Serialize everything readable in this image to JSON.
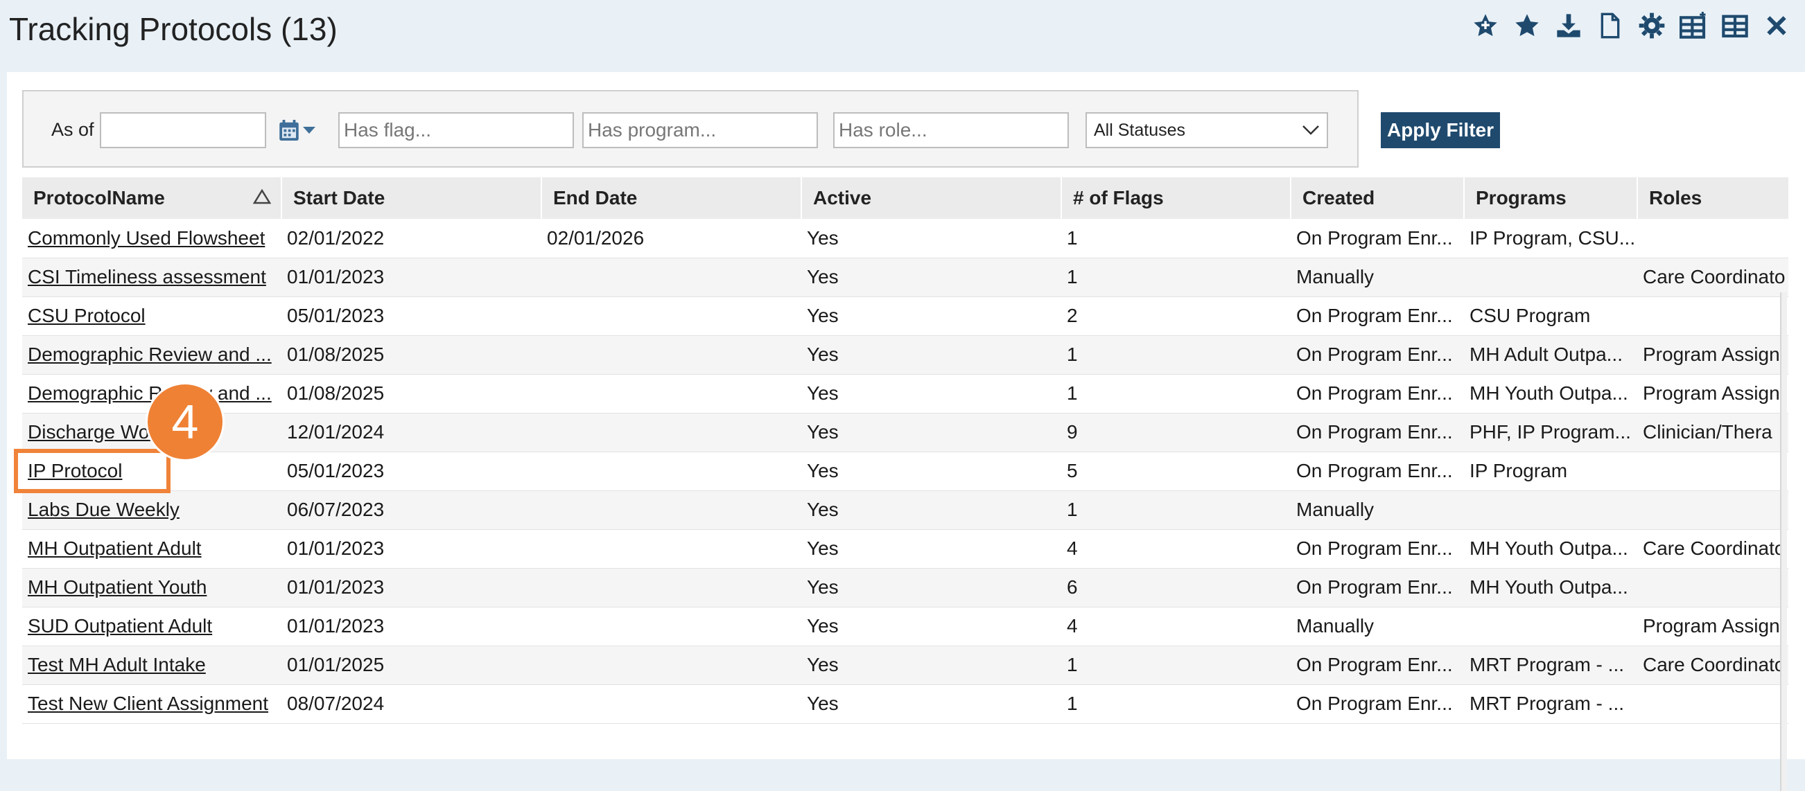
{
  "header": {
    "title": "Tracking Protocols (13)",
    "icons": [
      "add-favorite-icon",
      "star-icon",
      "download-icon",
      "document-icon",
      "gear-icon",
      "add-grid-icon",
      "grid-icon",
      "close-icon"
    ]
  },
  "filters": {
    "as_of_label": "As of",
    "as_of_value": "",
    "has_flag_placeholder": "Has flag...",
    "has_program_placeholder": "Has program...",
    "has_role_placeholder": "Has role...",
    "status_selected": "All Statuses",
    "apply_label": "Apply Filter"
  },
  "table": {
    "columns": [
      "ProtocolName",
      "Start Date",
      "End Date",
      "Active",
      "# of Flags",
      "Created",
      "Programs",
      "Roles"
    ],
    "rows": [
      [
        "Commonly Used Flowsheet",
        "02/01/2022",
        "02/01/2026",
        "Yes",
        "1",
        "On Program Enr...",
        "IP Program, CSU...",
        ""
      ],
      [
        "CSI Timeliness assessment",
        "01/01/2023",
        "",
        "Yes",
        "1",
        "Manually",
        "",
        "Care Coordinato"
      ],
      [
        "CSU Protocol",
        "05/01/2023",
        "",
        "Yes",
        "2",
        "On Program Enr...",
        "CSU Program",
        ""
      ],
      [
        "Demographic Review and ...",
        "01/08/2025",
        "",
        "Yes",
        "1",
        "On Program Enr...",
        "MH Adult Outpa...",
        "Program Assign"
      ],
      [
        "Demographic Review and ...",
        "01/08/2025",
        "",
        "Yes",
        "1",
        "On Program Enr...",
        "MH Youth Outpa...",
        "Program Assign"
      ],
      [
        "Discharge Work",
        "12/01/2024",
        "",
        "Yes",
        "9",
        "On Program Enr...",
        "PHF, IP Program...",
        "Clinician/Thera"
      ],
      [
        "IP Protocol",
        "05/01/2023",
        "",
        "Yes",
        "5",
        "On Program Enr...",
        "IP Program",
        ""
      ],
      [
        "Labs Due Weekly",
        "06/07/2023",
        "",
        "Yes",
        "1",
        "Manually",
        "",
        ""
      ],
      [
        "MH Outpatient Adult",
        "01/01/2023",
        "",
        "Yes",
        "4",
        "On Program Enr...",
        "MH Youth Outpa...",
        "Care Coordinato"
      ],
      [
        "MH Outpatient Youth",
        "01/01/2023",
        "",
        "Yes",
        "6",
        "On Program Enr...",
        "MH Youth Outpa...",
        ""
      ],
      [
        "SUD Outpatient Adult",
        "01/01/2023",
        "",
        "Yes",
        "4",
        "Manually",
        "",
        "Program Assign"
      ],
      [
        "Test MH Adult Intake",
        "01/01/2025",
        "",
        "Yes",
        "1",
        "On Program Enr...",
        "MRT Program - ...",
        "Care Coordinato"
      ],
      [
        "Test New Client Assignment",
        "08/07/2024",
        "",
        "Yes",
        "1",
        "On Program Enr...",
        "MRT Program - ...",
        ""
      ]
    ]
  },
  "annotation": {
    "step": "4"
  },
  "colors": {
    "accent": "#1f4a6e",
    "highlight": "#f0833a",
    "header_bg": "#e9f1f7"
  }
}
